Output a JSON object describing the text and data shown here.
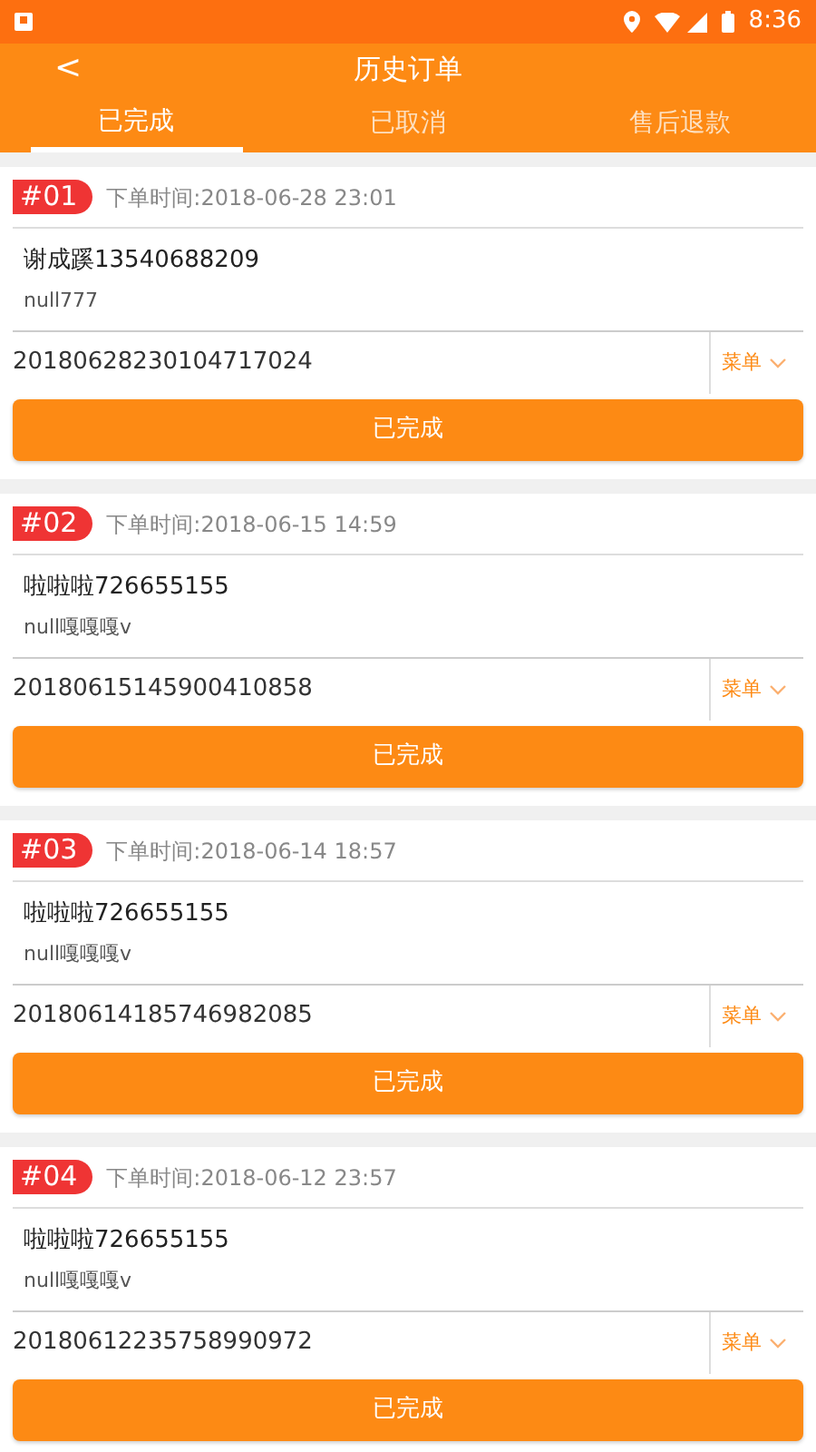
{
  "status_bar": {
    "time": "8:36"
  },
  "header": {
    "back": "<",
    "title": "历史订单"
  },
  "tabs": [
    {
      "label": "已完成",
      "selected": true
    },
    {
      "label": "已取消",
      "selected": false
    },
    {
      "label": "售后退款",
      "selected": false
    }
  ],
  "orders": [
    {
      "index": "#01",
      "time": "下单时间:2018-06-28 23:01",
      "customer": "谢成蹊13540688209",
      "note": "null777",
      "order_no": "20180628230104717024",
      "menu": "菜单",
      "action": "已完成"
    },
    {
      "index": "#02",
      "time": "下单时间:2018-06-15 14:59",
      "customer": "啦啦啦726655155",
      "note": "null嘎嘎嘎v",
      "order_no": "20180615145900410858",
      "menu": "菜单",
      "action": "已完成"
    },
    {
      "index": "#03",
      "time": "下单时间:2018-06-14 18:57",
      "customer": "啦啦啦726655155",
      "note": "null嘎嘎嘎v",
      "order_no": "20180614185746982085",
      "menu": "菜单",
      "action": "已完成"
    },
    {
      "index": "#04",
      "time": "下单时间:2018-06-12 23:57",
      "customer": "啦啦啦726655155",
      "note": "null嘎嘎嘎v",
      "order_no": "20180612235758990972",
      "menu": "菜单",
      "action": "已完成"
    }
  ]
}
